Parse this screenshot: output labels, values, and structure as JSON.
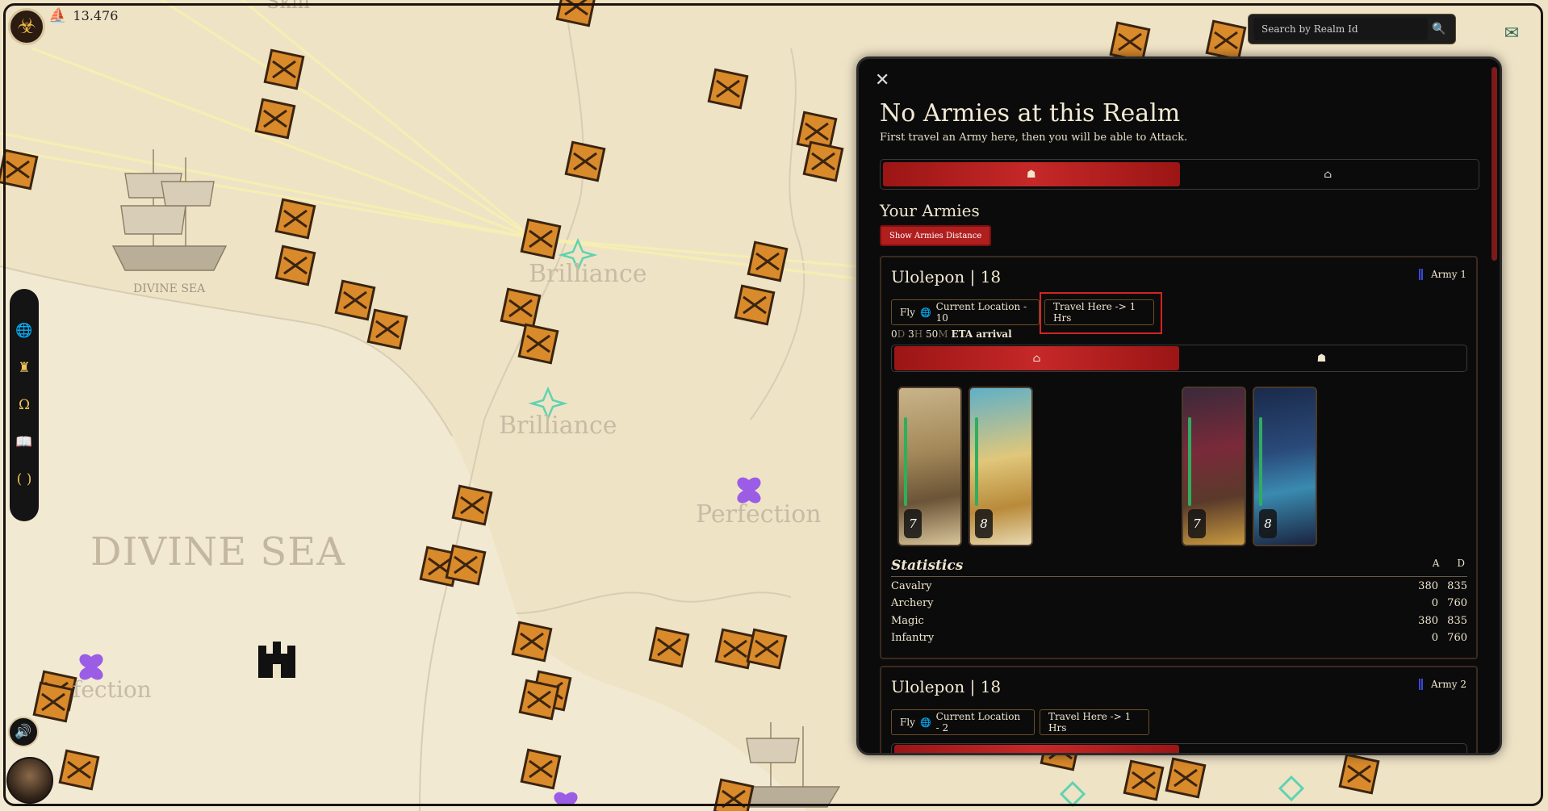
{
  "hud": {
    "resource_value": "13.476"
  },
  "map_labels": {
    "skill_label": "Skill",
    "divine_sea_small": "DIVINE SEA",
    "divine_sea_large": "DIVINE SEA",
    "brilliance_1": "Brilliance",
    "brilliance_2": "Brilliance",
    "perfection_1": "Perfection",
    "perfection_2": "fection"
  },
  "search": {
    "placeholder": "Search by Realm Id",
    "button_icon": "search-icon"
  },
  "sidebar": {
    "items": [
      {
        "icon": "globe-icon",
        "glyph": "🌐"
      },
      {
        "icon": "castle-icon",
        "glyph": "♜"
      },
      {
        "icon": "omega-icon",
        "glyph": "Ω"
      },
      {
        "icon": "book-icon",
        "glyph": "📖"
      },
      {
        "icon": "bracket-icon",
        "glyph": "( )"
      }
    ]
  },
  "panel": {
    "title": "No Armies at this Realm",
    "subtitle": "First travel an Army here, then you will be able to Attack.",
    "tabs": [
      {
        "icon": "helmet-icon",
        "glyph": "☗",
        "active": true
      },
      {
        "icon": "house-icon",
        "glyph": "⌂",
        "active": false
      }
    ],
    "section_title": "Your Armies",
    "show_distance_label": "Show Armies Distance",
    "armies": [
      {
        "name": "Ulolepon | 18",
        "index_label": "Army 1",
        "fly_label": "Fly",
        "location_label": "Current Location - 10",
        "travel_label": "Travel Here -> 1 Hrs",
        "eta": {
          "d": "0",
          "d_unit": "D",
          "h": "3",
          "h_unit": "H",
          "m": "50",
          "m_unit": "M",
          "label": "ETA arrival"
        },
        "subtabs": [
          {
            "icon": "house-icon",
            "glyph": "⌂",
            "active": true
          },
          {
            "icon": "helmet-icon",
            "glyph": "☗",
            "active": false
          }
        ],
        "cards": [
          {
            "level": "7",
            "name": "knight-card"
          },
          {
            "level": "8",
            "name": "bear-warrior-card"
          },
          {
            "level": "7",
            "name": "sorceress-card"
          },
          {
            "level": "8",
            "name": "wizard-card"
          }
        ],
        "stats": {
          "title": "Statistics",
          "col_a": "A",
          "col_d": "D",
          "rows": [
            {
              "name": "Cavalry",
              "a": "380",
              "d": "835"
            },
            {
              "name": "Archery",
              "a": "0",
              "d": "760"
            },
            {
              "name": "Magic",
              "a": "380",
              "d": "835"
            },
            {
              "name": "Infantry",
              "a": "0",
              "d": "760"
            }
          ]
        }
      },
      {
        "name": "Ulolepon | 18",
        "index_label": "Army 2",
        "fly_label": "Fly",
        "location_label": "Current Location - 2",
        "travel_label": "Travel Here -> 1 Hrs"
      }
    ]
  }
}
